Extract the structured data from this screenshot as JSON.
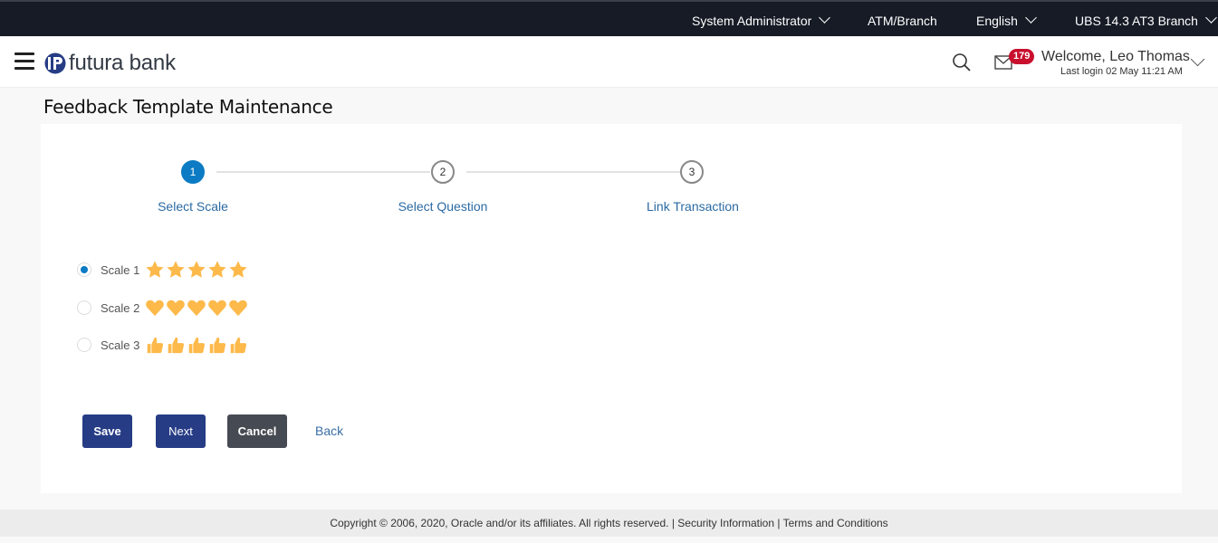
{
  "topbar": {
    "role": "System Administrator",
    "entity": "ATM/Branch",
    "language": "English",
    "branch": "UBS 14.3 AT3 Branch"
  },
  "header": {
    "brand": "futura bank",
    "notification_count": "179",
    "welcome": "Welcome, Leo Thomas",
    "last_login": "Last login 02 May 11:21 AM"
  },
  "page": {
    "title": "Feedback Template Maintenance"
  },
  "stepper": {
    "current_step": 1,
    "steps": [
      {
        "number": "1",
        "label": "Select Scale"
      },
      {
        "number": "2",
        "label": "Select Question"
      },
      {
        "number": "3",
        "label": "Link Transaction"
      }
    ]
  },
  "scales": {
    "selected": "Scale 1",
    "options": [
      {
        "label": "Scale 1",
        "icon": "star-icon",
        "count": 5
      },
      {
        "label": "Scale 2",
        "icon": "heart-icon",
        "count": 5
      },
      {
        "label": "Scale 3",
        "icon": "thumbs-up-icon",
        "count": 5
      }
    ],
    "icon_color": "#fdb94a"
  },
  "actions": {
    "save": "Save",
    "next": "Next",
    "cancel": "Cancel",
    "back": "Back"
  },
  "footer": {
    "copyright": "Copyright © 2006, 2020, Oracle and/or its affiliates. All rights reserved.",
    "separator": "|",
    "security": "Security Information",
    "terms": "Terms and Conditions"
  },
  "colors": {
    "topbar_bg": "#161b26",
    "primary_button": "#263c85",
    "secondary_button": "#464a52",
    "active_step": "#0c7bc4",
    "link": "#2b6aa3",
    "badge": "#c8102e"
  }
}
